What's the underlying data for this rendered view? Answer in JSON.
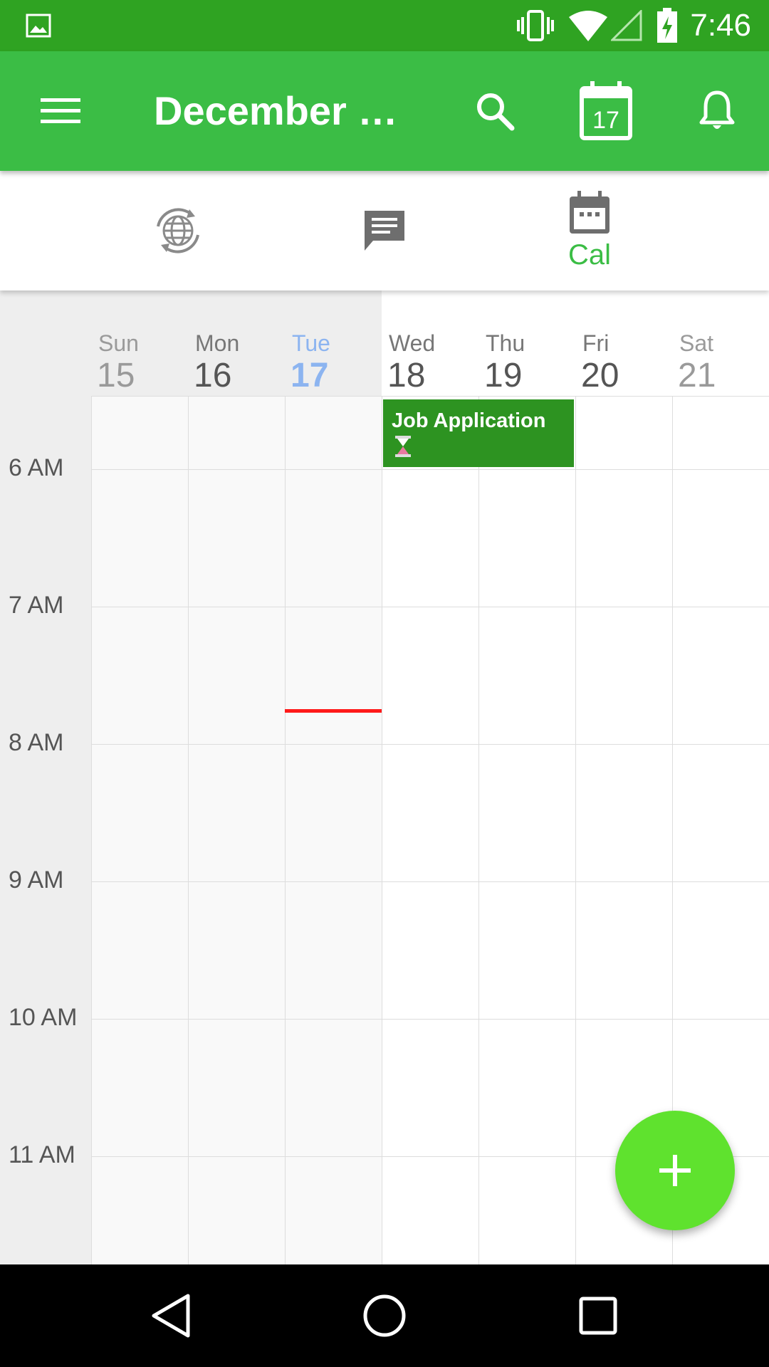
{
  "status_bar": {
    "time": "7:46",
    "icons": [
      "image-notification-icon",
      "vibrate-icon",
      "wifi-icon",
      "cell-signal-icon",
      "battery-charging-icon"
    ]
  },
  "app_bar": {
    "title": "December 2…",
    "actions": [
      "menu-icon",
      "search-icon",
      "today-calendar-icon",
      "bell-icon"
    ],
    "today_icon_number": "17"
  },
  "tabs": [
    {
      "icon": "globe-sync-icon",
      "label": ""
    },
    {
      "icon": "chat-bubble-icon",
      "label": ""
    },
    {
      "icon": "calendar-icon",
      "label": "Cal",
      "selected": true
    }
  ],
  "calendar": {
    "days": [
      {
        "name": "Sun",
        "num": "15",
        "state": "past"
      },
      {
        "name": "Mon",
        "num": "16",
        "state": "past"
      },
      {
        "name": "Tue",
        "num": "17",
        "state": "today"
      },
      {
        "name": "Wed",
        "num": "18",
        "state": "future"
      },
      {
        "name": "Thu",
        "num": "19",
        "state": "future"
      },
      {
        "name": "Fri",
        "num": "20",
        "state": "future"
      },
      {
        "name": "Sat",
        "num": "21",
        "state": "weekend"
      }
    ],
    "hours": [
      "6 AM",
      "7 AM",
      "8 AM",
      "9 AM",
      "10 AM",
      "11 AM"
    ],
    "events": [
      {
        "title": "Job Application",
        "day": "Wed",
        "icon": "hourglass-icon"
      }
    ]
  },
  "fab": {
    "icon": "plus-icon"
  },
  "nav_bar": {
    "buttons": [
      "back-icon",
      "home-icon",
      "recents-icon"
    ]
  },
  "colors": {
    "status_bar": "#2fa322",
    "app_bar": "#3bbd45",
    "accent": "#3bbd45",
    "event": "#2d9321",
    "fab": "#5fe22e",
    "now_line": "#ff1a1a",
    "today_text": "#8cb4f0"
  }
}
